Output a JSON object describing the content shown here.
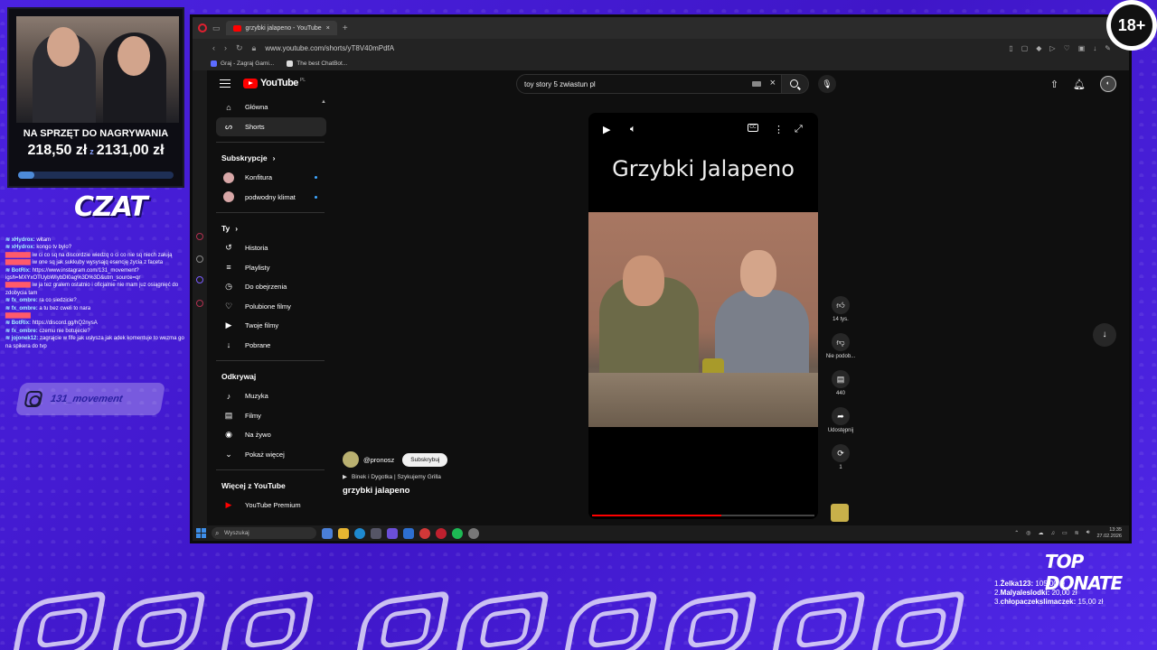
{
  "stream": {
    "goal_title": "NA SPRZĘT DO NAGRYWANIA",
    "goal_current": "218,50 zł",
    "goal_separator": "z",
    "goal_target": "2131,00 zł",
    "goal_progress_percent": 10.3,
    "chat_title": "CZAT",
    "chat": [
      {
        "user": "xHydrox:",
        "text": "witam",
        "red": false
      },
      {
        "user": "xHydrox:",
        "text": "kongo tv bylo?",
        "red": false
      },
      {
        "user": "",
        "text": "iw ci co sq na discordzie wiedzq o ci co nie sq niech załują",
        "red": true
      },
      {
        "user": "",
        "text": "iw one sq jak sukkuby wysysajq esencję życia z faceta",
        "red": true
      },
      {
        "user": "BotRix:",
        "text": "https://www.instagram.com/131_movement?igsh=MXYxOTUybWIybDI0ag%3D%3D&utm_source=qr",
        "red": false
      },
      {
        "user": "",
        "text": "iw ja tez grałem ostatnio i oficjalnie nie mam juz osiągnięć do zdobycia tam",
        "red": true
      },
      {
        "user": "fx_ombre:",
        "text": "ra co siedzicie?",
        "red": false
      },
      {
        "user": "fx_ombre:",
        "text": "a tu bez cweli to nara",
        "red": false
      },
      {
        "user": "",
        "text": "",
        "red": true
      },
      {
        "user": "BotRix:",
        "text": "https://discord.gg/hQ2nysA",
        "red": false
      },
      {
        "user": "fx_ombre:",
        "text": "czemu nie botujecie?",
        "red": false
      },
      {
        "user": "jojonek12:",
        "text": "zagrajcie w fife jak usłysza jak adek komentuje to wezma go na spikera do tvp",
        "red": false
      }
    ],
    "instagram_label": "131_movement",
    "age_badge": "18+",
    "top_donate_title": "TOP DONATE",
    "donations": [
      {
        "rank": "1.",
        "name": "Żelka123:",
        "amount": "105,00 zł"
      },
      {
        "rank": "2.",
        "name": "Malyaleslodki:",
        "amount": "20,00 zł"
      },
      {
        "rank": "3.",
        "name": "chłopaczekslimaczek:",
        "amount": "15,00 zł"
      }
    ]
  },
  "browser": {
    "tab_title": "grzybki jalapeno - YouTube",
    "url": "www.youtube.com/shorts/yT8V40mPdfA",
    "bookmarks": [
      "Graj - Zagraj Gami...",
      "The best ChatBot..."
    ]
  },
  "youtube": {
    "logo": "YouTube",
    "region": "PL",
    "search_value": "toy story 5 zwiastun pl",
    "sidebar": {
      "main": [
        {
          "label": "Główna",
          "icon": "home-icon",
          "glyph": "⌂",
          "active": false
        },
        {
          "label": "Shorts",
          "icon": "shorts-icon",
          "glyph": "ᔕ",
          "active": true
        }
      ],
      "subscriptions_heading": "Subskrypcje",
      "subscriptions": [
        {
          "label": "Konfitura"
        },
        {
          "label": "podwodny klimat"
        }
      ],
      "you_heading": "Ty",
      "you": [
        {
          "label": "Historia",
          "icon": "history-icon",
          "glyph": "↺"
        },
        {
          "label": "Playlisty",
          "icon": "playlists-icon",
          "glyph": "≡"
        },
        {
          "label": "Do obejrzenia",
          "icon": "watch-later-icon",
          "glyph": "◷"
        },
        {
          "label": "Polubione filmy",
          "icon": "like-icon",
          "glyph": "♡"
        },
        {
          "label": "Twoje filmy",
          "icon": "your-videos-icon",
          "glyph": "▶"
        },
        {
          "label": "Pobrane",
          "icon": "download-icon",
          "glyph": "↓"
        }
      ],
      "explore_heading": "Odkrywaj",
      "explore": [
        {
          "label": "Muzyka",
          "icon": "music-icon",
          "glyph": "♪"
        },
        {
          "label": "Filmy",
          "icon": "movies-icon",
          "glyph": "▤"
        },
        {
          "label": "Na żywo",
          "icon": "live-icon",
          "glyph": "◉"
        },
        {
          "label": "Pokaż więcej",
          "icon": "chevron-down-icon",
          "glyph": "⌄"
        }
      ],
      "more_heading": "Więcej z YouTube",
      "more": [
        {
          "label": "YouTube Premium",
          "icon": "youtube-premium-icon",
          "glyph": "▶"
        }
      ]
    },
    "short": {
      "overlay_title": "Grzybki Jalapeno",
      "progress_percent": 58,
      "likes": "14 tys.",
      "dislike_label": "Nie podob...",
      "comments": "440",
      "share_label": "Udostępnij",
      "remix_count": "1",
      "channel": "@pronosz",
      "subscribe_label": "Subskrybuj",
      "audio": "Binek i Dygotka | Szykujemy Grilla",
      "title": "grzybki jalapeno"
    }
  },
  "taskbar": {
    "search_placeholder": "Wyszukaj",
    "time": "13:35",
    "date": "27.02.2026"
  }
}
